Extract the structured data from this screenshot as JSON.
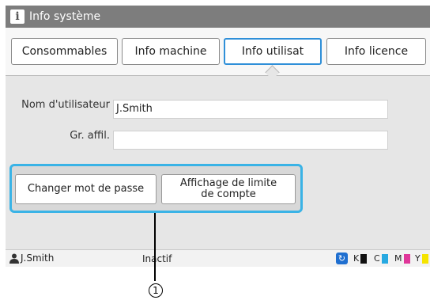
{
  "window": {
    "title": "Info système",
    "icon": "info-icon"
  },
  "tabs": [
    {
      "label": "Consommables",
      "active": false
    },
    {
      "label": "Info machine",
      "active": false
    },
    {
      "label": "Info utilisat",
      "active": true
    },
    {
      "label": "Info licence",
      "active": false
    }
  ],
  "form": {
    "username_label": "Nom d'utilisateur",
    "username_value": "J.Smith",
    "group_label": "Gr. affil.",
    "group_value": ""
  },
  "buttons": {
    "change_password": "Changer mot de passe",
    "limit_display_line1": "Affichage de limite",
    "limit_display_line2": "de compte",
    "group_border_color": "#3ab3e6"
  },
  "statusbar": {
    "user": "J.Smith",
    "state": "Inactif",
    "inks": [
      {
        "label": "K",
        "color": "#111111"
      },
      {
        "label": "C",
        "color": "#27a9e1"
      },
      {
        "label": "M",
        "color": "#e0379a"
      },
      {
        "label": "Y",
        "color": "#f5e400"
      }
    ]
  },
  "callout": {
    "number": "1"
  }
}
